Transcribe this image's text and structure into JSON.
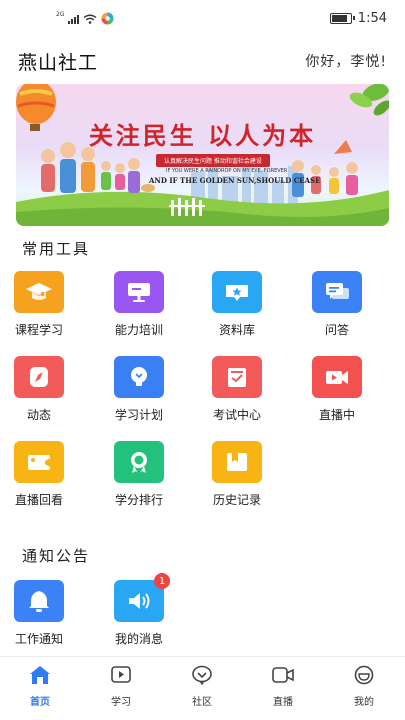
{
  "status_bar": {
    "network": "2G",
    "time": "1:54"
  },
  "header": {
    "title": "燕山社工",
    "greeting": "你好，李悦!"
  },
  "banner": {
    "title": "关注民生 以人为本",
    "ribbon": "认真解决民生问题  推动和谐社会建设",
    "subtitle_small": "IF YOU WERE A RAINDROP ON MY EYE, FOREVER",
    "subtitle": "AND IF THE GOLDEN SUN,SHOULD CEASE"
  },
  "tools": {
    "title": "常用工具",
    "items": [
      {
        "label": "课程学习",
        "icon": "graduation-cap-icon",
        "color": "#f5a21f"
      },
      {
        "label": "能力培训",
        "icon": "presentation-board-icon",
        "color": "#9a56f0"
      },
      {
        "label": "资料库",
        "icon": "star-folder-icon",
        "color": "#29a7f4"
      },
      {
        "label": "问答",
        "icon": "chat-bubbles-icon",
        "color": "#3a82f6"
      },
      {
        "label": "动态",
        "icon": "compass-icon",
        "color": "#f35a5a"
      },
      {
        "label": "学习计划",
        "icon": "lightbulb-icon",
        "color": "#3a7ff3"
      },
      {
        "label": "考试中心",
        "icon": "checklist-icon",
        "color": "#f35a5a"
      },
      {
        "label": "直播中",
        "icon": "video-camera-icon",
        "color": "#f35050"
      },
      {
        "label": "直播回看",
        "icon": "video-replay-icon",
        "color": "#f7b413"
      },
      {
        "label": "学分排行",
        "icon": "medal-icon",
        "color": "#22c27d"
      },
      {
        "label": "历史记录",
        "icon": "history-card-icon",
        "color": "#f7b413"
      }
    ]
  },
  "notices": {
    "title": "通知公告",
    "items": [
      {
        "label": "工作通知",
        "icon": "bell-icon",
        "color": "#3a82f6",
        "badge": ""
      },
      {
        "label": "我的消息",
        "icon": "speaker-icon",
        "color": "#29a7f4",
        "badge": "1"
      }
    ]
  },
  "tabbar": {
    "active_color": "#2f7bf5",
    "items": [
      {
        "label": "首页",
        "icon": "home-icon"
      },
      {
        "label": "学习",
        "icon": "play-icon"
      },
      {
        "label": "社区",
        "icon": "community-chat-icon"
      },
      {
        "label": "直播",
        "icon": "live-camera-icon"
      },
      {
        "label": "我的",
        "icon": "smile-icon"
      }
    ]
  }
}
